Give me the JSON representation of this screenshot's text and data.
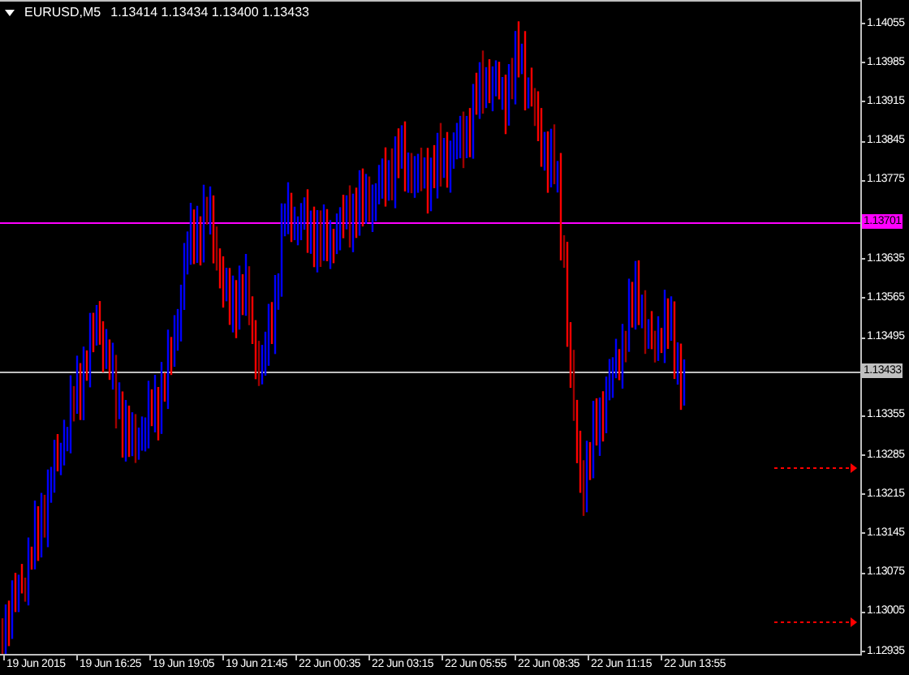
{
  "header": {
    "symbol": "EURUSD,M5",
    "quotes": "1.13414 1.13434 1.13400 1.13433"
  },
  "price_axis": [
    "1.14055",
    "1.13985",
    "1.13915",
    "1.13845",
    "1.13775",
    "1.13635",
    "1.13565",
    "1.13495",
    "1.13355",
    "1.13285",
    "1.13215",
    "1.13145",
    "1.13075",
    "1.13005",
    "1.12935"
  ],
  "levels": [
    {
      "label": "1.13701",
      "color": "#ff00ff"
    },
    {
      "label": "1.13433",
      "color": "#c0c0c0"
    }
  ],
  "time_axis": [
    "19 Jun 2015",
    "19 Jun 16:25",
    "19 Jun 19:05",
    "19 Jun 21:45",
    "22 Jun 00:35",
    "22 Jun 03:15",
    "22 Jun 05:55",
    "22 Jun 08:35",
    "22 Jun 11:15",
    "22 Jun 13:55"
  ]
}
